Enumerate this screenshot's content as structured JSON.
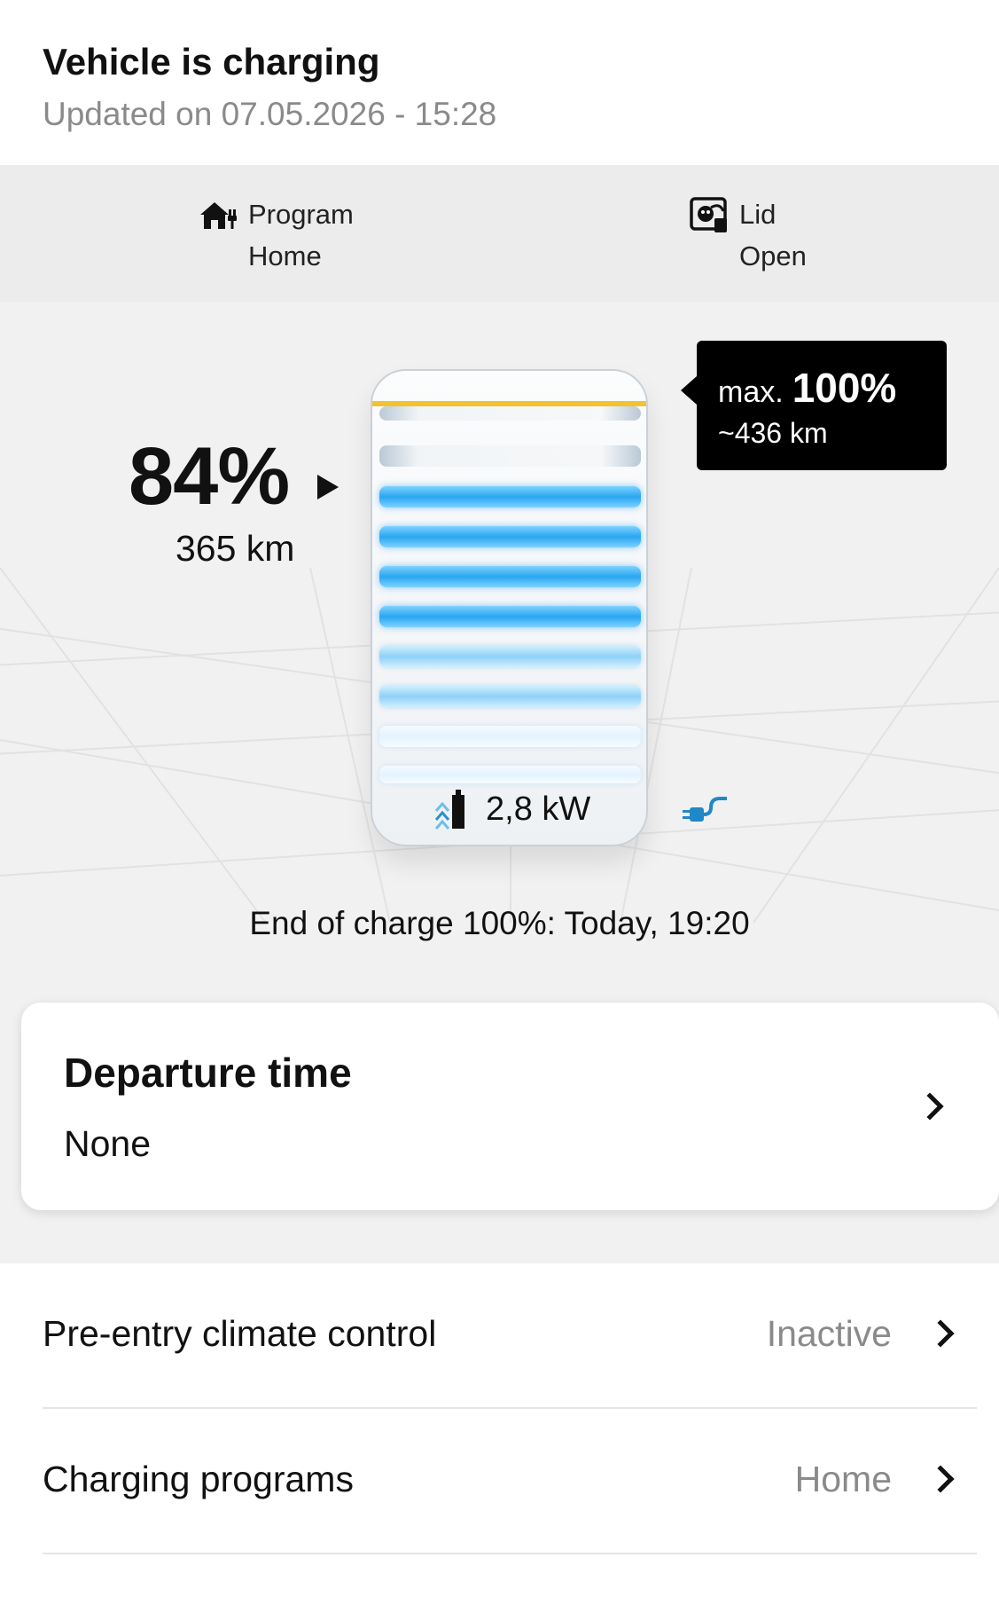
{
  "header": {
    "title": "Vehicle is charging",
    "updated": "Updated on 07.05.2026 - 15:28"
  },
  "status": {
    "program": {
      "icon": "home-charging-icon",
      "label": "Program",
      "value": "Home"
    },
    "lid": {
      "icon": "charging-lid-icon",
      "label": "Lid",
      "value": "Open"
    }
  },
  "battery": {
    "state_of_charge": "84%",
    "range": "365 km",
    "charge_level_fraction": 0.84,
    "power": "2,8 kW",
    "max_line_color": "#f2c230",
    "fill_color": "#29a6f0"
  },
  "tooltip": {
    "prefix": "max.",
    "max_value": "100%",
    "max_range": "~436 km"
  },
  "end_of_charge": "End of charge 100%: Today, 19:20",
  "departure": {
    "title": "Departure time",
    "value": "None"
  },
  "list": [
    {
      "label": "Pre-entry climate control",
      "value": "Inactive"
    },
    {
      "label": "Charging programs",
      "value": "Home"
    }
  ]
}
